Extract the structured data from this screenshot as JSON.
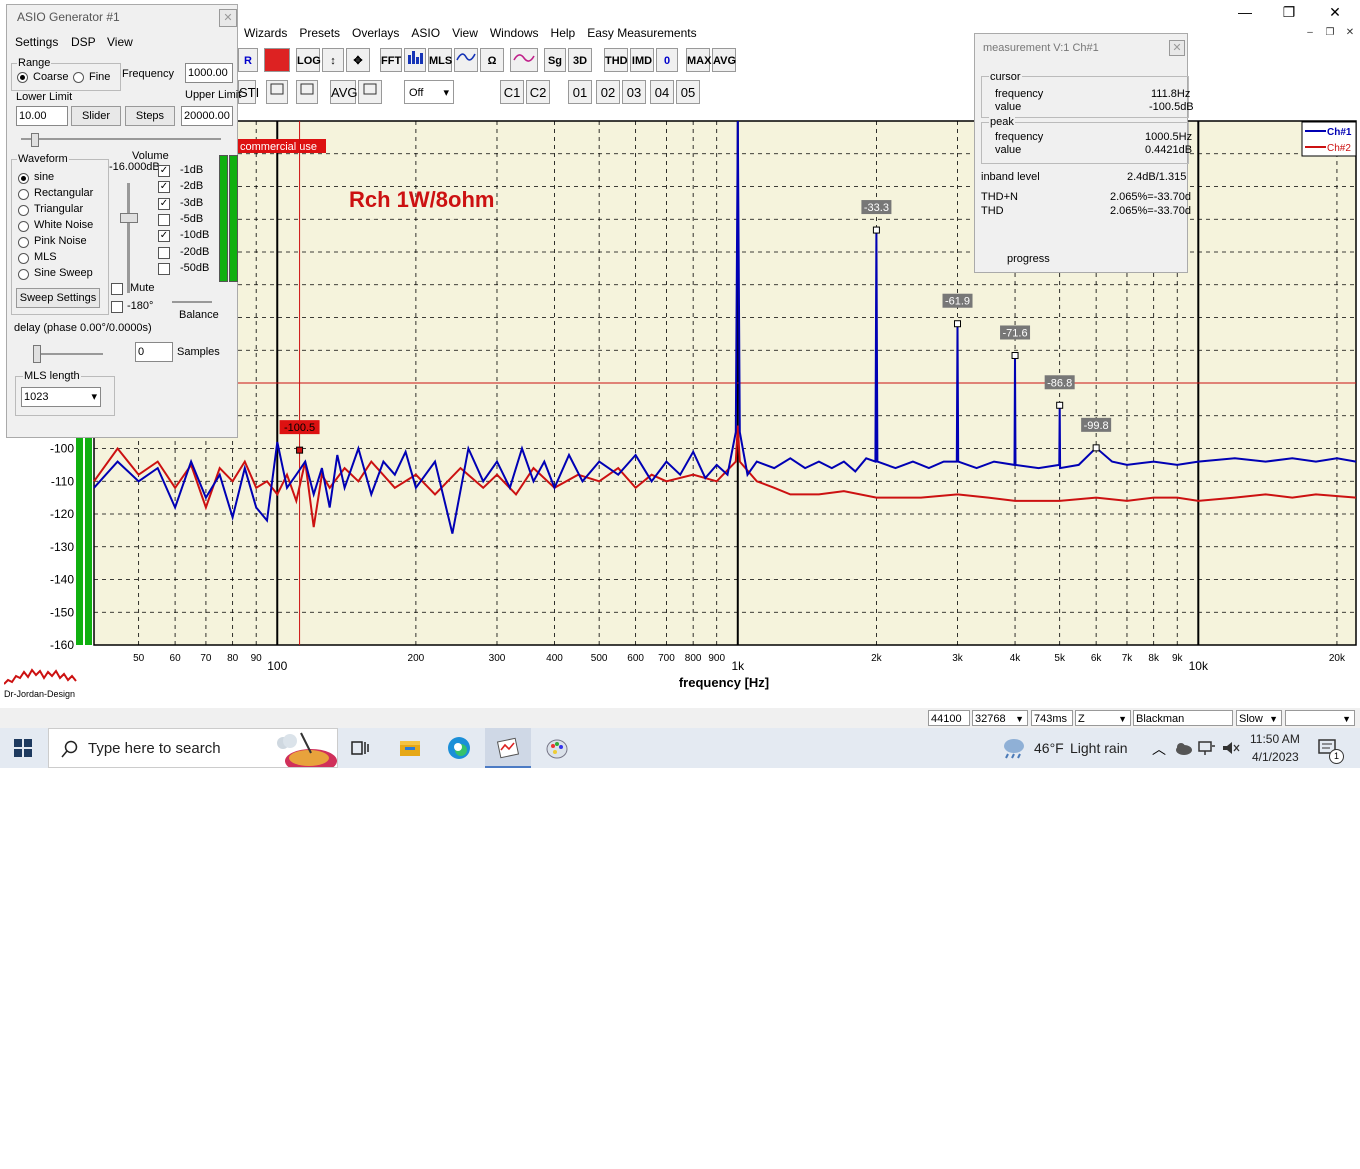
{
  "app": {
    "menu": [
      "Wizards",
      "Presets",
      "Overlays",
      "ASIO",
      "View",
      "Windows",
      "Help",
      "Easy Measurements"
    ],
    "win_controls": {
      "minimize": "—",
      "maximize": "❐",
      "close": "✕"
    },
    "mdi_controls": {
      "minimize": "–",
      "restore": "❐",
      "close": "✕"
    },
    "toolbar1": [
      "R",
      "",
      "LOG",
      "↕",
      "✥",
      "FFT",
      "",
      "MLS",
      "",
      "Ω",
      "",
      "Sg",
      "3D",
      "THD",
      "IMD",
      "0",
      "MAX",
      "AVG"
    ],
    "toolbar2": [
      "STI",
      "",
      "",
      "AVG",
      "",
      "C1",
      "C2",
      "01",
      "02",
      "03",
      "04",
      "05"
    ],
    "dropdown_value": "Off"
  },
  "generator": {
    "title": "ASIO Generator #1",
    "menu": [
      "Settings",
      "DSP",
      "View"
    ],
    "range_label": "Range",
    "coarse_label": "Coarse",
    "fine_label": "Fine",
    "frequency_label": "Frequency",
    "frequency_value": "1000.00",
    "lower_limit_label": "Lower Limit",
    "lower_limit_value": "10.00",
    "upper_limit_label": "Upper Limit",
    "upper_limit_value": "20000.00",
    "slider_label": "Slider",
    "steps_label": "Steps",
    "waveform_label": "Waveform",
    "waveforms": [
      "sine",
      "Rectangular",
      "Triangular",
      "White Noise",
      "Pink Noise",
      "MLS",
      "Sine Sweep"
    ],
    "selected_waveform": "sine",
    "sweep_settings_label": "Sweep Settings",
    "volume_label": "Volume",
    "volume_value": "-16.000dB",
    "attenuators": [
      {
        "label": "-1dB",
        "checked": true
      },
      {
        "label": "-2dB",
        "checked": true
      },
      {
        "label": "-3dB",
        "checked": true
      },
      {
        "label": "-5dB",
        "checked": false
      },
      {
        "label": "-10dB",
        "checked": true
      },
      {
        "label": "-20dB",
        "checked": false
      },
      {
        "label": "-50dB",
        "checked": false
      }
    ],
    "mute_label": "Mute",
    "invert_label": "-180°",
    "balance_label": "Balance",
    "delay_label": "delay (phase  0.00°/0.0000s)",
    "samples_value": "0",
    "samples_label": "Samples",
    "mls_length_label": "MLS length",
    "mls_length_value": "1023"
  },
  "measurement": {
    "title": "measurement V:1 Ch#1",
    "cursor_label": "cursor",
    "cursor_frequency_label": "frequency",
    "cursor_frequency_value": "111.8Hz",
    "cursor_value_label": "value",
    "cursor_value_value": "-100.5dB",
    "peak_label": "peak",
    "peak_frequency_label": "frequency",
    "peak_frequency_value": "1000.5Hz",
    "peak_value_label": "value",
    "peak_value_value": "0.4421dB",
    "inband_label": "inband level",
    "inband_value": "2.4dB/1.315",
    "thdn_label": "THD+N",
    "thdn_value": "2.065%=-33.70d",
    "thd_label": "THD",
    "thd_value": "2.065%=-33.70d",
    "progress_label": "progress"
  },
  "chart_data": {
    "type": "line",
    "title": "Rch 1W/8ohm",
    "xlabel": "frequency [Hz]",
    "ylabel": "",
    "xscale": "log",
    "xlim": [
      40,
      22000
    ],
    "ylim": [
      -160,
      0
    ],
    "grid": true,
    "legend_position": "top-right",
    "watermark": "commercial use",
    "x_ticks": [
      {
        "v": 50,
        "label": "50"
      },
      {
        "v": 60,
        "label": "60"
      },
      {
        "v": 70,
        "label": "70"
      },
      {
        "v": 80,
        "label": "80"
      },
      {
        "v": 90,
        "label": "90"
      },
      {
        "v": 100,
        "label": "100"
      },
      {
        "v": 200,
        "label": "200"
      },
      {
        "v": 300,
        "label": "300"
      },
      {
        "v": 400,
        "label": "400"
      },
      {
        "v": 500,
        "label": "500"
      },
      {
        "v": 600,
        "label": "600"
      },
      {
        "v": 700,
        "label": "700"
      },
      {
        "v": 800,
        "label": "800"
      },
      {
        "v": 900,
        "label": "900"
      },
      {
        "v": 1000,
        "label": "1k"
      },
      {
        "v": 2000,
        "label": "2k"
      },
      {
        "v": 3000,
        "label": "3k"
      },
      {
        "v": 4000,
        "label": "4k"
      },
      {
        "v": 5000,
        "label": "5k"
      },
      {
        "v": 6000,
        "label": "6k"
      },
      {
        "v": 7000,
        "label": "7k"
      },
      {
        "v": 8000,
        "label": "8k"
      },
      {
        "v": 9000,
        "label": "9k"
      },
      {
        "v": 10000,
        "label": "10k"
      },
      {
        "v": 20000,
        "label": "20k"
      }
    ],
    "y_ticks": [
      -100,
      -110,
      -120,
      -130,
      -140,
      -150,
      -160
    ],
    "series": [
      {
        "name": "Ch#1",
        "color": "#0000b4",
        "points": [
          [
            40,
            -112
          ],
          [
            45,
            -104
          ],
          [
            50,
            -110
          ],
          [
            55,
            -106
          ],
          [
            60,
            -118
          ],
          [
            65,
            -104
          ],
          [
            70,
            -115
          ],
          [
            75,
            -108
          ],
          [
            80,
            -121
          ],
          [
            85,
            -106
          ],
          [
            90,
            -118
          ],
          [
            95,
            -122
          ],
          [
            100,
            -98
          ],
          [
            105,
            -112
          ],
          [
            110,
            -108
          ],
          [
            115,
            -104
          ],
          [
            120,
            -114
          ],
          [
            125,
            -106
          ],
          [
            130,
            -118
          ],
          [
            135,
            -102
          ],
          [
            140,
            -112
          ],
          [
            150,
            -100
          ],
          [
            160,
            -114
          ],
          [
            170,
            -104
          ],
          [
            180,
            -108
          ],
          [
            190,
            -101
          ],
          [
            200,
            -112
          ],
          [
            220,
            -104
          ],
          [
            240,
            -126
          ],
          [
            260,
            -100
          ],
          [
            280,
            -110
          ],
          [
            300,
            -104
          ],
          [
            320,
            -112
          ],
          [
            340,
            -100
          ],
          [
            360,
            -110
          ],
          [
            380,
            -104
          ],
          [
            400,
            -112
          ],
          [
            430,
            -102
          ],
          [
            460,
            -110
          ],
          [
            500,
            -104
          ],
          [
            550,
            -108
          ],
          [
            600,
            -102
          ],
          [
            650,
            -110
          ],
          [
            700,
            -104
          ],
          [
            750,
            -108
          ],
          [
            800,
            -101
          ],
          [
            850,
            -109
          ],
          [
            900,
            -105
          ],
          [
            950,
            -108
          ],
          [
            990,
            -95
          ],
          [
            1000,
            0
          ],
          [
            1010,
            -95
          ],
          [
            1050,
            -108
          ],
          [
            1100,
            -104
          ],
          [
            1200,
            -106
          ],
          [
            1300,
            -103
          ],
          [
            1400,
            -106
          ],
          [
            1500,
            -104
          ],
          [
            1600,
            -106
          ],
          [
            1700,
            -104
          ],
          [
            1800,
            -107
          ],
          [
            1900,
            -103
          ],
          [
            1990,
            -104
          ],
          [
            2000,
            -33.3
          ],
          [
            2010,
            -104
          ],
          [
            2200,
            -106
          ],
          [
            2400,
            -104
          ],
          [
            2600,
            -106
          ],
          [
            2800,
            -104
          ],
          [
            2990,
            -104
          ],
          [
            3000,
            -61.9
          ],
          [
            3010,
            -104
          ],
          [
            3300,
            -106
          ],
          [
            3600,
            -104
          ],
          [
            3990,
            -105
          ],
          [
            4000,
            -71.6
          ],
          [
            4010,
            -105
          ],
          [
            4500,
            -106
          ],
          [
            4990,
            -105
          ],
          [
            5000,
            -86.8
          ],
          [
            5010,
            -106
          ],
          [
            5500,
            -105
          ],
          [
            6000,
            -99.8
          ],
          [
            6500,
            -104
          ],
          [
            7000,
            -105
          ],
          [
            8000,
            -104
          ],
          [
            9000,
            -105
          ],
          [
            10000,
            -104
          ],
          [
            12000,
            -103
          ],
          [
            14000,
            -104
          ],
          [
            16000,
            -103
          ],
          [
            18000,
            -104
          ],
          [
            20000,
            -103
          ],
          [
            22000,
            -104
          ]
        ]
      },
      {
        "name": "Ch#2",
        "color": "#cc1111",
        "points": [
          [
            40,
            -110
          ],
          [
            45,
            -100
          ],
          [
            50,
            -108
          ],
          [
            55,
            -104
          ],
          [
            60,
            -112
          ],
          [
            65,
            -105
          ],
          [
            70,
            -118
          ],
          [
            75,
            -106
          ],
          [
            80,
            -110
          ],
          [
            85,
            -104
          ],
          [
            90,
            -112
          ],
          [
            95,
            -110
          ],
          [
            100,
            -114
          ],
          [
            105,
            -108
          ],
          [
            110,
            -116
          ],
          [
            115,
            -104
          ],
          [
            120,
            -124
          ],
          [
            125,
            -108
          ],
          [
            130,
            -112
          ],
          [
            140,
            -106
          ],
          [
            150,
            -110
          ],
          [
            160,
            -104
          ],
          [
            180,
            -112
          ],
          [
            200,
            -108
          ],
          [
            220,
            -114
          ],
          [
            250,
            -106
          ],
          [
            280,
            -112
          ],
          [
            300,
            -108
          ],
          [
            330,
            -114
          ],
          [
            360,
            -106
          ],
          [
            400,
            -112
          ],
          [
            450,
            -108
          ],
          [
            500,
            -110
          ],
          [
            550,
            -106
          ],
          [
            600,
            -112
          ],
          [
            650,
            -108
          ],
          [
            700,
            -110
          ],
          [
            800,
            -108
          ],
          [
            900,
            -110
          ],
          [
            990,
            -104
          ],
          [
            1000,
            -93
          ],
          [
            1010,
            -104
          ],
          [
            1100,
            -110
          ],
          [
            1200,
            -112
          ],
          [
            1300,
            -114
          ],
          [
            1500,
            -114
          ],
          [
            1700,
            -113
          ],
          [
            2000,
            -115
          ],
          [
            2500,
            -115
          ],
          [
            3000,
            -114
          ],
          [
            3500,
            -115
          ],
          [
            4000,
            -116
          ],
          [
            5000,
            -116
          ],
          [
            6000,
            -115
          ],
          [
            7000,
            -116
          ],
          [
            8000,
            -115
          ],
          [
            9000,
            -115
          ],
          [
            10000,
            -116
          ],
          [
            12000,
            -115
          ],
          [
            14000,
            -114
          ],
          [
            16000,
            -115
          ],
          [
            18000,
            -114
          ],
          [
            22000,
            -115
          ]
        ]
      }
    ],
    "markers": [
      {
        "x": 111.8,
        "y": -100.5,
        "label": "-100.5",
        "style": "cursor"
      },
      {
        "x": 2000,
        "y": -33.3,
        "label": "-33.3"
      },
      {
        "x": 3000,
        "y": -61.9,
        "label": "-61.9"
      },
      {
        "x": 4000,
        "y": -71.6,
        "label": "-71.6"
      },
      {
        "x": 5000,
        "y": -86.8,
        "label": "-86.8"
      },
      {
        "x": 6000,
        "y": -99.8,
        "label": "-99.8"
      }
    ],
    "cursor": {
      "x": 111.8,
      "y": -80
    }
  },
  "logo_text": "Dr-Jordan-Design",
  "statusbar": {
    "samplerate": "44100",
    "fftsize": "32768",
    "time": "743ms",
    "zoom": "Z",
    "window": "Blackman",
    "speed": "Slow",
    "extra": ""
  },
  "taskbar": {
    "search_placeholder": "Type here to search",
    "weather_temp": "46°F",
    "weather_text": "Light rain",
    "time": "11:50 AM",
    "date": "4/1/2023",
    "notifications": "1"
  }
}
